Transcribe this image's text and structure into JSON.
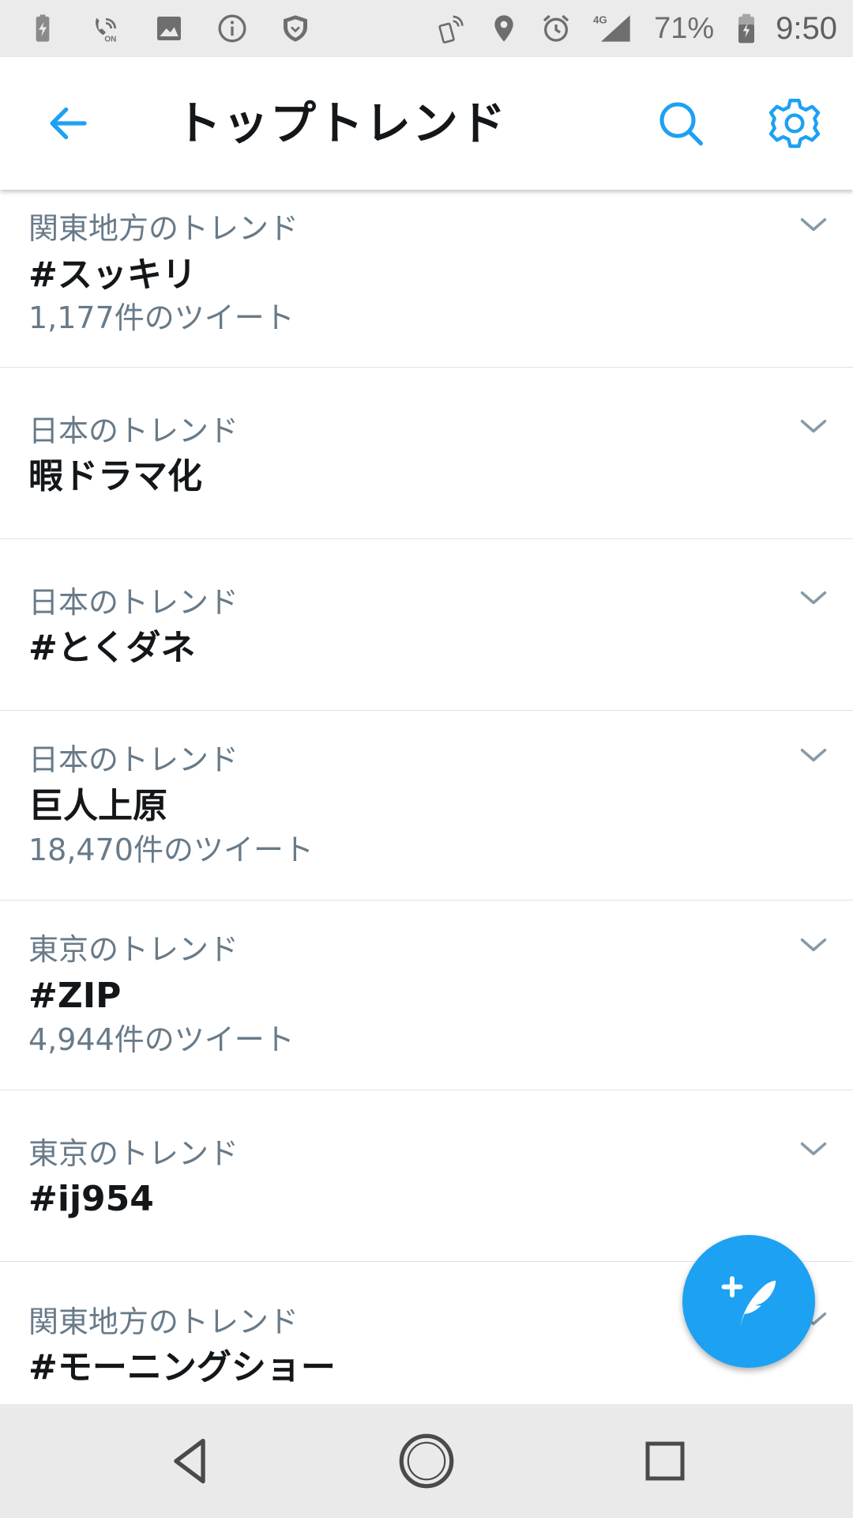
{
  "status_bar": {
    "battery_percent": "71%",
    "time": "9:50",
    "network": "4G",
    "icons_left": [
      "battery-charging-icon",
      "wifi-calling-icon",
      "image-icon",
      "info-icon",
      "shield-icon"
    ],
    "icons_right": [
      "nfc-icon",
      "location-icon",
      "alarm-icon",
      "signal-icon",
      "battery-icon"
    ]
  },
  "app_bar": {
    "title": "トップトレンド",
    "accent_color": "#1da1f2"
  },
  "trends": [
    {
      "context": "関東地方のトレンド",
      "name": "#スッキリ",
      "count": "1,177件のツイート"
    },
    {
      "context": "日本のトレンド",
      "name": "暇ドラマ化",
      "count": ""
    },
    {
      "context": "日本のトレンド",
      "name": "#とくダネ",
      "count": ""
    },
    {
      "context": "日本のトレンド",
      "name": "巨人上原",
      "count": "18,470件のツイート"
    },
    {
      "context": "東京のトレンド",
      "name": "#ZIP",
      "count": "4,944件のツイート"
    },
    {
      "context": "東京のトレンド",
      "name": "#ij954",
      "count": ""
    },
    {
      "context": "関東地方のトレンド",
      "name": "#モーニングショー",
      "count": ""
    }
  ],
  "fab": {
    "icon": "compose-tweet-icon"
  },
  "nav_bar": {
    "buttons": [
      "back-nav-icon",
      "home-nav-icon",
      "recents-nav-icon"
    ]
  }
}
